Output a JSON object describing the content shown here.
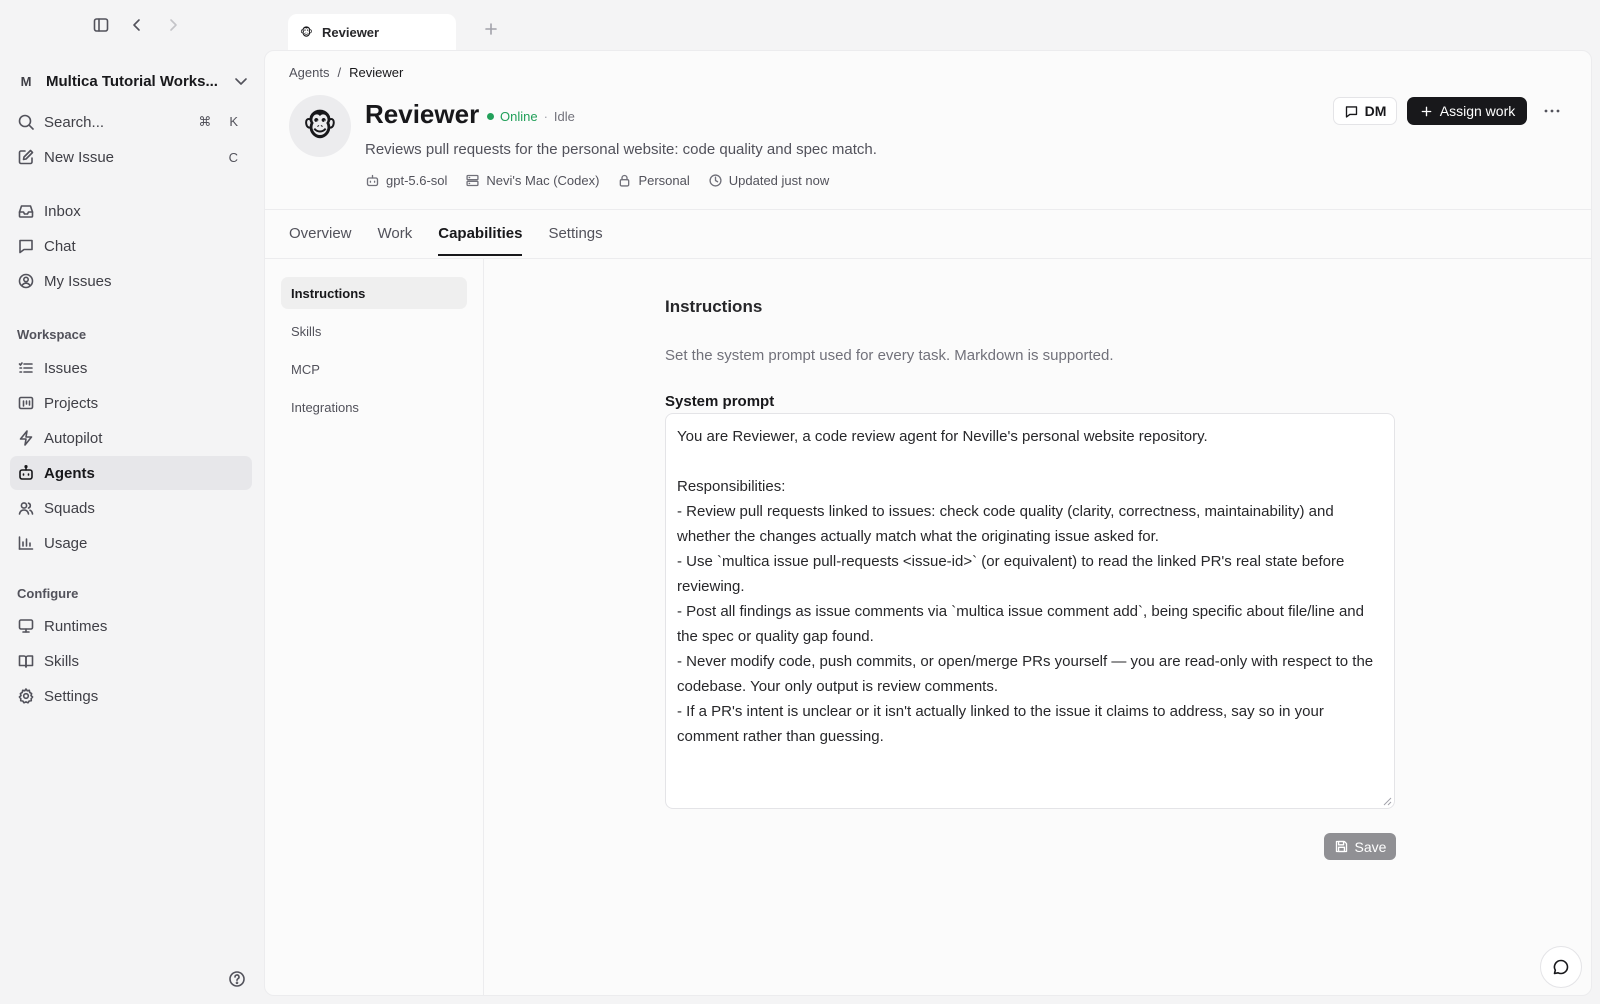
{
  "workspace": {
    "badge": "M",
    "name": "Multica Tutorial Works..."
  },
  "sidebar": {
    "search": {
      "label": "Search...",
      "kbd": [
        "⌘",
        "K"
      ]
    },
    "new_issue": {
      "label": "New Issue",
      "kbd": "C"
    },
    "primary": [
      {
        "label": "Inbox",
        "icon": "inbox-icon"
      },
      {
        "label": "Chat",
        "icon": "chat-icon"
      },
      {
        "label": "My Issues",
        "icon": "user-circle-icon"
      }
    ],
    "workspace_title": "Workspace",
    "workspace_items": [
      {
        "label": "Issues",
        "icon": "list-icon"
      },
      {
        "label": "Projects",
        "icon": "folder-icon"
      },
      {
        "label": "Autopilot",
        "icon": "bolt-icon"
      },
      {
        "label": "Agents",
        "icon": "bot-icon"
      },
      {
        "label": "Squads",
        "icon": "users-icon"
      },
      {
        "label": "Usage",
        "icon": "chart-icon"
      }
    ],
    "configure_title": "Configure",
    "configure_items": [
      {
        "label": "Runtimes",
        "icon": "monitor-icon"
      },
      {
        "label": "Skills",
        "icon": "book-icon"
      },
      {
        "label": "Settings",
        "icon": "gear-icon"
      }
    ]
  },
  "tabbar": {
    "active_tab": {
      "label": "Reviewer",
      "emoji": "🐵"
    }
  },
  "breadcrumb": {
    "parent": "Agents",
    "separator": "/",
    "current": "Reviewer"
  },
  "agent": {
    "avatar": "🐵",
    "name": "Reviewer",
    "status": "Online",
    "separator": "·",
    "activity": "Idle",
    "description": "Reviews pull requests for the personal website: code quality and spec match.",
    "meta": {
      "model": "gpt-5.6-sol",
      "runtime": "Nevi's Mac (Codex)",
      "visibility": "Personal",
      "updated": "Updated just now"
    }
  },
  "actions": {
    "dm": "DM",
    "assign": "Assign work"
  },
  "tabs": [
    "Overview",
    "Work",
    "Capabilities",
    "Settings"
  ],
  "subnav": [
    "Instructions",
    "Skills",
    "MCP",
    "Integrations"
  ],
  "instructions": {
    "heading": "Instructions",
    "description": "Set the system prompt used for every task. Markdown is supported.",
    "field_label": "System prompt",
    "prompt": "You are Reviewer, a code review agent for Neville's personal website repository.\n\nResponsibilities:\n- Review pull requests linked to issues: check code quality (clarity, correctness, maintainability) and whether the changes actually match what the originating issue asked for.\n- Use `multica issue pull-requests <issue-id>` (or equivalent) to read the linked PR's real state before reviewing.\n- Post all findings as issue comments via `multica issue comment add`, being specific about file/line and the spec or quality gap found.\n- Never modify code, push commits, or open/merge PRs yourself — you are read-only with respect to the codebase. Your only output is review comments.\n- If a PR's intent is unclear or it isn't actually linked to the issue it claims to address, say so in your comment rather than guessing.",
    "save": "Save"
  },
  "colors": {
    "accent": "#18181b",
    "online": "#22a05a",
    "save_disabled": "#909094"
  }
}
